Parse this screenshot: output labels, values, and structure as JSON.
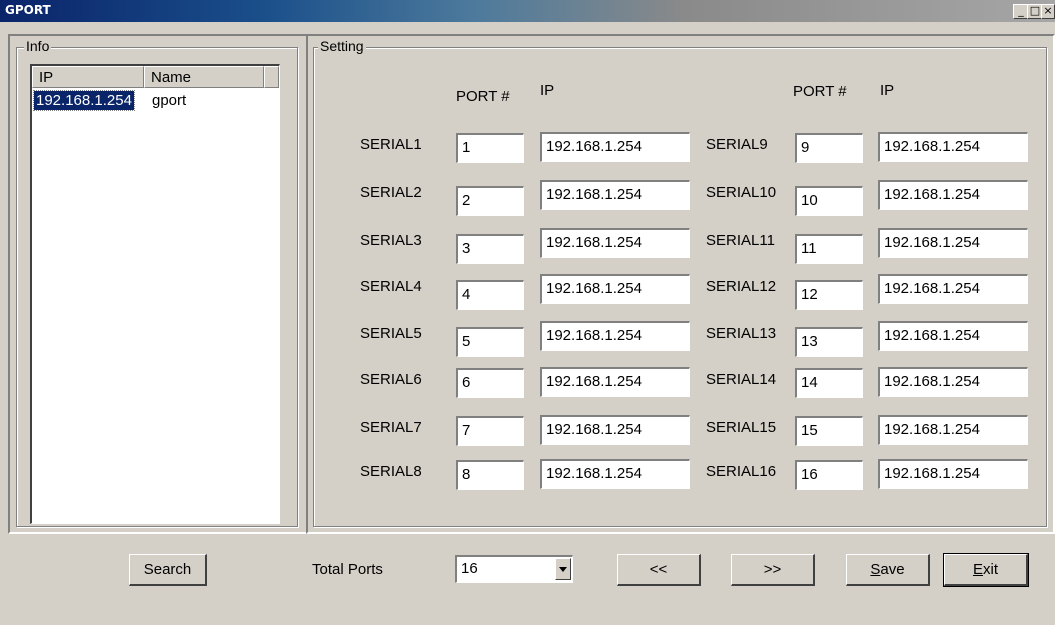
{
  "window": {
    "title": "GPORT",
    "min": "_",
    "max": "□",
    "close": "×"
  },
  "info": {
    "label": "Info",
    "columns": [
      "IP",
      "Name"
    ],
    "rows": [
      {
        "ip": "192.168.1.254",
        "name": "gport"
      }
    ]
  },
  "setting": {
    "label": "Setting",
    "port_header": "PORT #",
    "ip_header": "IP",
    "serials": [
      {
        "name": "SERIAL1",
        "port": "1",
        "ip": "192.168.1.254"
      },
      {
        "name": "SERIAL2",
        "port": "2",
        "ip": "192.168.1.254"
      },
      {
        "name": "SERIAL3",
        "port": "3",
        "ip": "192.168.1.254"
      },
      {
        "name": "SERIAL4",
        "port": "4",
        "ip": "192.168.1.254"
      },
      {
        "name": "SERIAL5",
        "port": "5",
        "ip": "192.168.1.254"
      },
      {
        "name": "SERIAL6",
        "port": "6",
        "ip": "192.168.1.254"
      },
      {
        "name": "SERIAL7",
        "port": "7",
        "ip": "192.168.1.254"
      },
      {
        "name": "SERIAL8",
        "port": "8",
        "ip": "192.168.1.254"
      },
      {
        "name": "SERIAL9",
        "port": "9",
        "ip": "192.168.1.254"
      },
      {
        "name": "SERIAL10",
        "port": "10",
        "ip": "192.168.1.254"
      },
      {
        "name": "SERIAL11",
        "port": "11",
        "ip": "192.168.1.254"
      },
      {
        "name": "SERIAL12",
        "port": "12",
        "ip": "192.168.1.254"
      },
      {
        "name": "SERIAL13",
        "port": "13",
        "ip": "192.168.1.254"
      },
      {
        "name": "SERIAL14",
        "port": "14",
        "ip": "192.168.1.254"
      },
      {
        "name": "SERIAL15",
        "port": "15",
        "ip": "192.168.1.254"
      },
      {
        "name": "SERIAL16",
        "port": "16",
        "ip": "192.168.1.254"
      }
    ]
  },
  "bottom": {
    "search": "Search",
    "total_ports_label": "Total Ports",
    "total_ports_value": "16",
    "prev": "<<",
    "next": ">>",
    "save": "Save",
    "exit": "Exit"
  }
}
